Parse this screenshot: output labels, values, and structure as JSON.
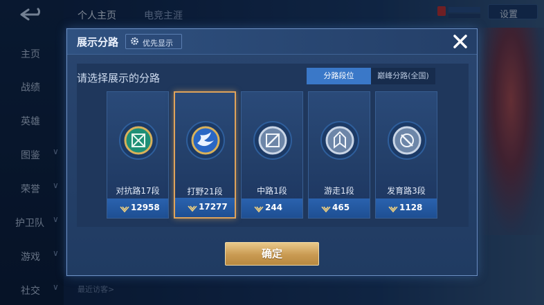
{
  "background": {
    "tabs": [
      "个人主页",
      "电竞主涯"
    ],
    "settings_label": "设置",
    "sidebar": [
      {
        "label": "主页",
        "chevron": false
      },
      {
        "label": "战绩",
        "chevron": false
      },
      {
        "label": "英雄",
        "chevron": false
      },
      {
        "label": "图鉴",
        "chevron": true
      },
      {
        "label": "荣誉",
        "chevron": true
      },
      {
        "label": "护卫队",
        "chevron": true
      },
      {
        "label": "游戏",
        "chevron": true
      },
      {
        "label": "社交",
        "chevron": true
      }
    ],
    "recent_visitors_label": "最近访客>"
  },
  "dialog": {
    "title": "展示分路",
    "priority_label": "优先显示",
    "heading": "请选择展示的分路",
    "tabs": [
      {
        "label": "分路段位",
        "active": true
      },
      {
        "label": "巅峰分路(全国)",
        "active": false
      }
    ],
    "confirm_label": "确定",
    "cards": [
      {
        "role": "对抗路17段",
        "score": "12958",
        "selected": false,
        "icon": "clash-lane-emblem-icon"
      },
      {
        "role": "打野21段",
        "score": "17277",
        "selected": true,
        "icon": "jungle-emblem-icon"
      },
      {
        "role": "中路1段",
        "score": "244",
        "selected": false,
        "icon": "mid-lane-emblem-icon"
      },
      {
        "role": "游走1段",
        "score": "465",
        "selected": false,
        "icon": "roam-emblem-icon"
      },
      {
        "role": "发育路3段",
        "score": "1128",
        "selected": false,
        "icon": "farm-lane-emblem-icon"
      }
    ]
  },
  "colors": {
    "accent_tab": "#3a78c8",
    "selected_border": "#e0a35a",
    "confirm_gold": "#c99a52"
  }
}
